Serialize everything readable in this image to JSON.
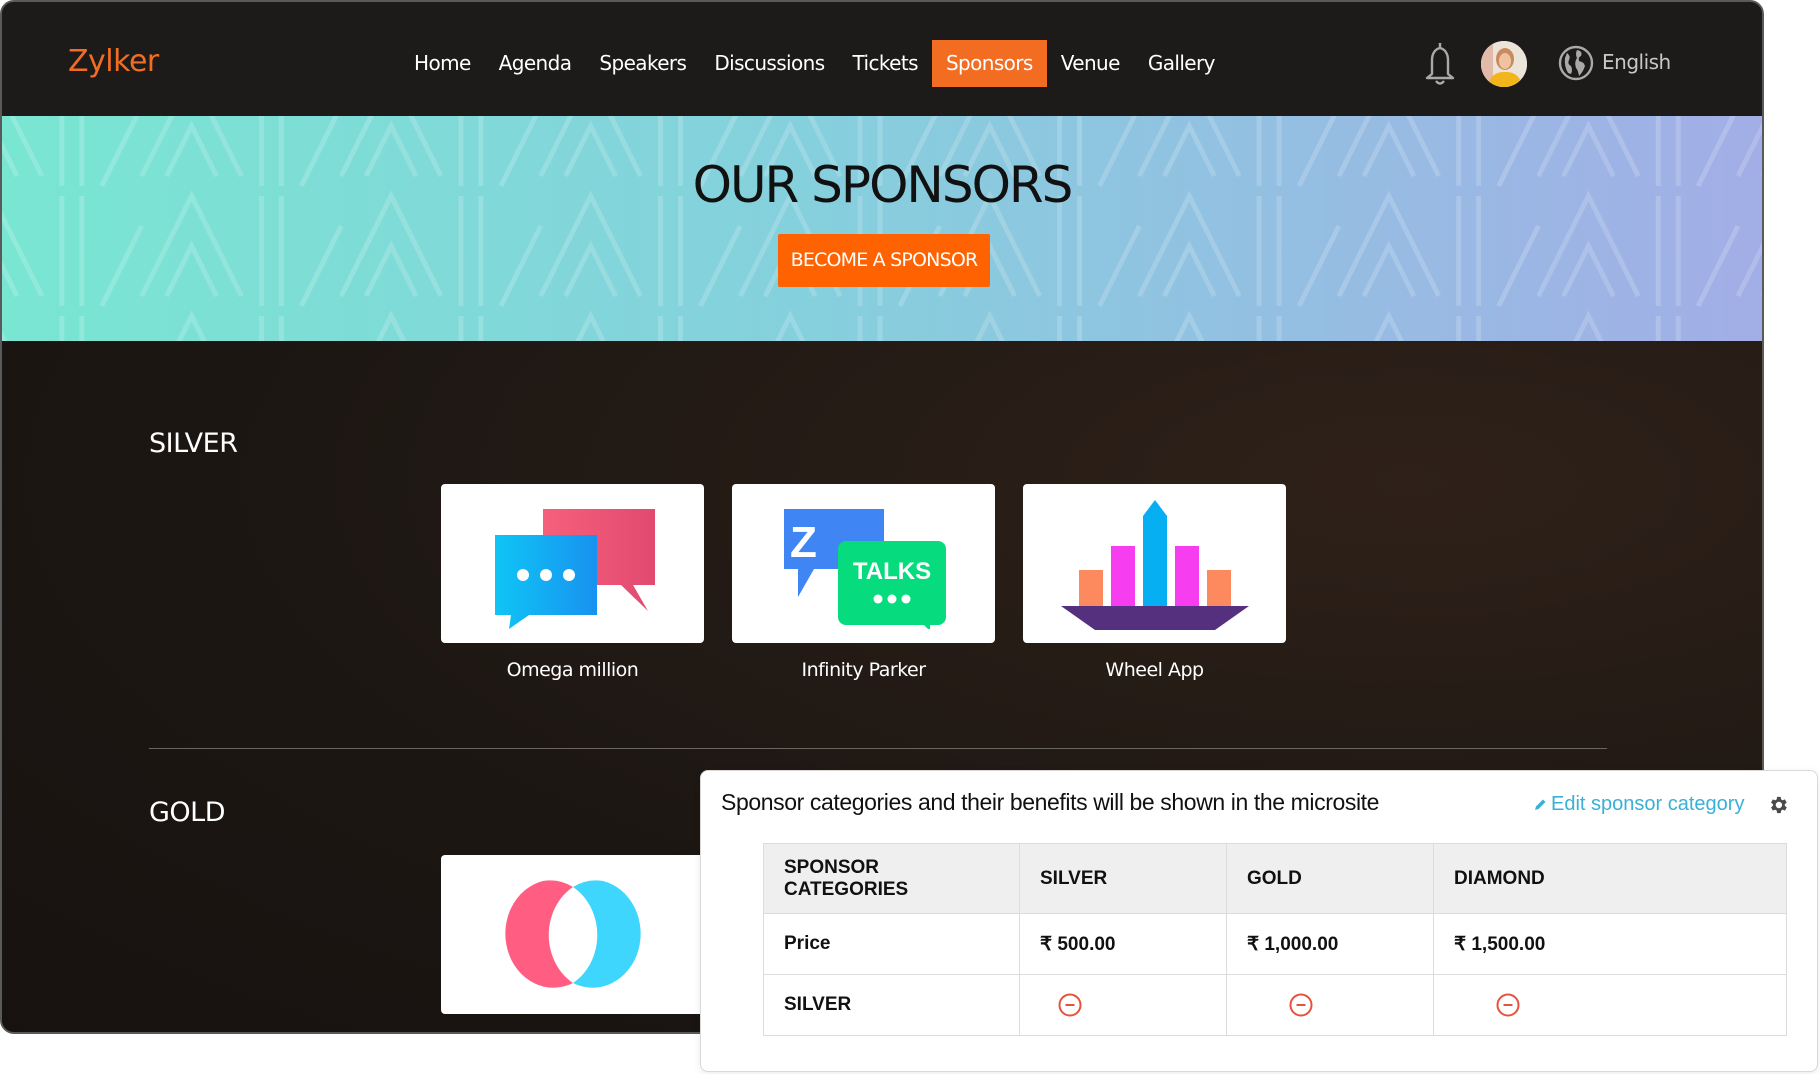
{
  "header": {
    "logo": "Zylker",
    "nav": [
      {
        "label": "Home",
        "active": false
      },
      {
        "label": "Agenda",
        "active": false
      },
      {
        "label": "Speakers",
        "active": false
      },
      {
        "label": "Discussions",
        "active": false
      },
      {
        "label": "Tickets",
        "active": false
      },
      {
        "label": "Sponsors",
        "active": true
      },
      {
        "label": "Venue",
        "active": false
      },
      {
        "label": "Gallery",
        "active": false
      }
    ],
    "icons": {
      "notifications": "bell-icon",
      "profile": "avatar",
      "language": "globe-icon"
    },
    "language": "English"
  },
  "banner": {
    "title": "OUR SPONSORS",
    "button_label": "BECOME A SPONSOR"
  },
  "sections": [
    {
      "label": "SILVER",
      "sponsors": [
        {
          "name": "Omega million",
          "logo": "chat-bubbles-logo"
        },
        {
          "name": "Infinity Parker",
          "logo": "z-talks-logo"
        },
        {
          "name": "Wheel App",
          "logo": "bar-boat-logo"
        }
      ]
    },
    {
      "label": "GOLD",
      "sponsors": [
        {
          "name": "",
          "logo": "overlapping-rings-logo"
        }
      ]
    }
  ],
  "popup": {
    "title": "Sponsor categories and their benefits will be shown in the microsite",
    "edit_label": "Edit sponsor category",
    "table": {
      "headers": [
        "SPONSOR CATEGORIES",
        "SILVER",
        "GOLD",
        "DIAMOND"
      ],
      "rows": [
        {
          "label": "Price",
          "values": [
            "₹ 500.00",
            "₹ 1,000.00",
            "₹ 1,500.00"
          ]
        },
        {
          "label": "SILVER",
          "values": [
            "remove-icon",
            "remove-icon",
            "remove-icon"
          ]
        }
      ]
    }
  },
  "colors": {
    "accent": "#f26c22",
    "button": "#ff6200",
    "link": "#3ab0d6",
    "remove": "#e5533d"
  }
}
